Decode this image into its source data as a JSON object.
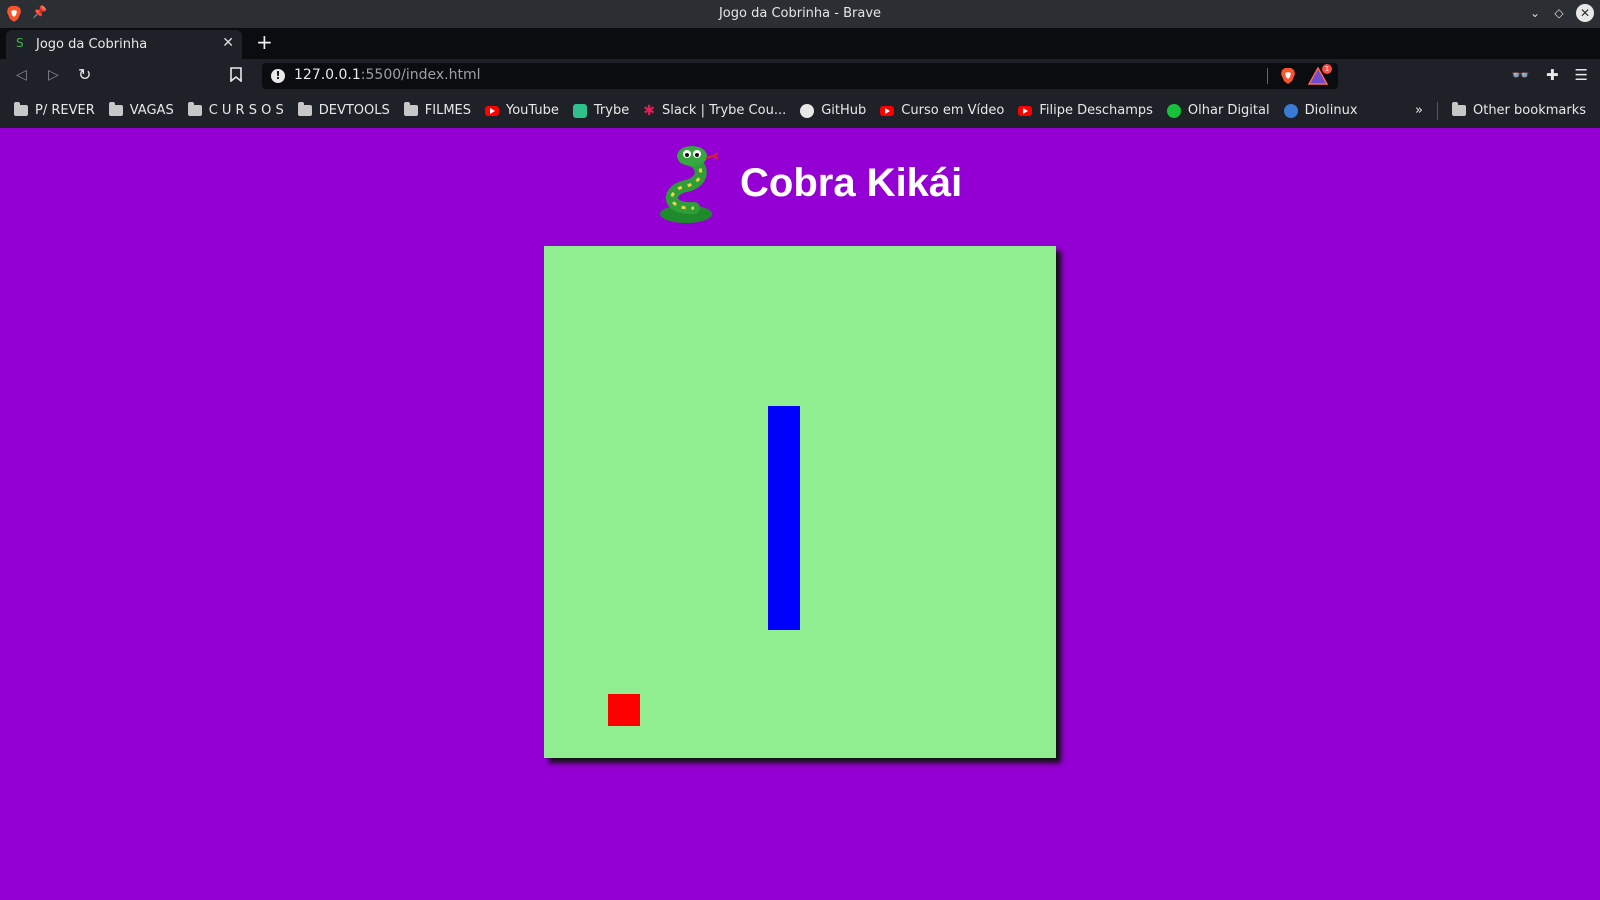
{
  "window": {
    "title": "Jogo da Cobrinha - Brave"
  },
  "tab": {
    "label": "Jogo da Cobrinha"
  },
  "url": {
    "host": "127.0.0.1",
    "path": ":5500/index.html"
  },
  "rewards_badge": "1",
  "bookmarks": [
    {
      "label": "P/ REVER",
      "icon": "folder-icon"
    },
    {
      "label": "VAGAS",
      "icon": "folder-icon"
    },
    {
      "label": "C U R S O S",
      "icon": "folder-icon"
    },
    {
      "label": "DEVTOOLS",
      "icon": "folder-icon"
    },
    {
      "label": "FILMES",
      "icon": "folder-icon"
    },
    {
      "label": "YouTube",
      "icon": "youtube-icon"
    },
    {
      "label": "Trybe",
      "icon": "trybe-icon"
    },
    {
      "label": "Slack | Trybe Cou...",
      "icon": "slack-icon"
    },
    {
      "label": "GitHub",
      "icon": "github-icon"
    },
    {
      "label": "Curso em Vídeo",
      "icon": "youtube-icon"
    },
    {
      "label": "Filipe Deschamps",
      "icon": "youtube-icon"
    },
    {
      "label": "Olhar Digital",
      "icon": "olhar-digital-icon"
    },
    {
      "label": "Diolinux",
      "icon": "diolinux-icon"
    }
  ],
  "other_bookmarks": "Other bookmarks",
  "game": {
    "title": "Cobra Kikái",
    "grid_cells": 16,
    "snake_cells": [
      [
        7,
        5
      ],
      [
        7,
        6
      ],
      [
        7,
        7
      ],
      [
        7,
        8
      ],
      [
        7,
        9
      ],
      [
        7,
        10
      ],
      [
        7,
        11
      ]
    ],
    "food_cell": [
      2,
      14
    ],
    "colors": {
      "background": "#9400d3",
      "board": "#90ee90",
      "snake": "#0000ff",
      "food": "#ff0000",
      "title": "#ffffff"
    }
  }
}
